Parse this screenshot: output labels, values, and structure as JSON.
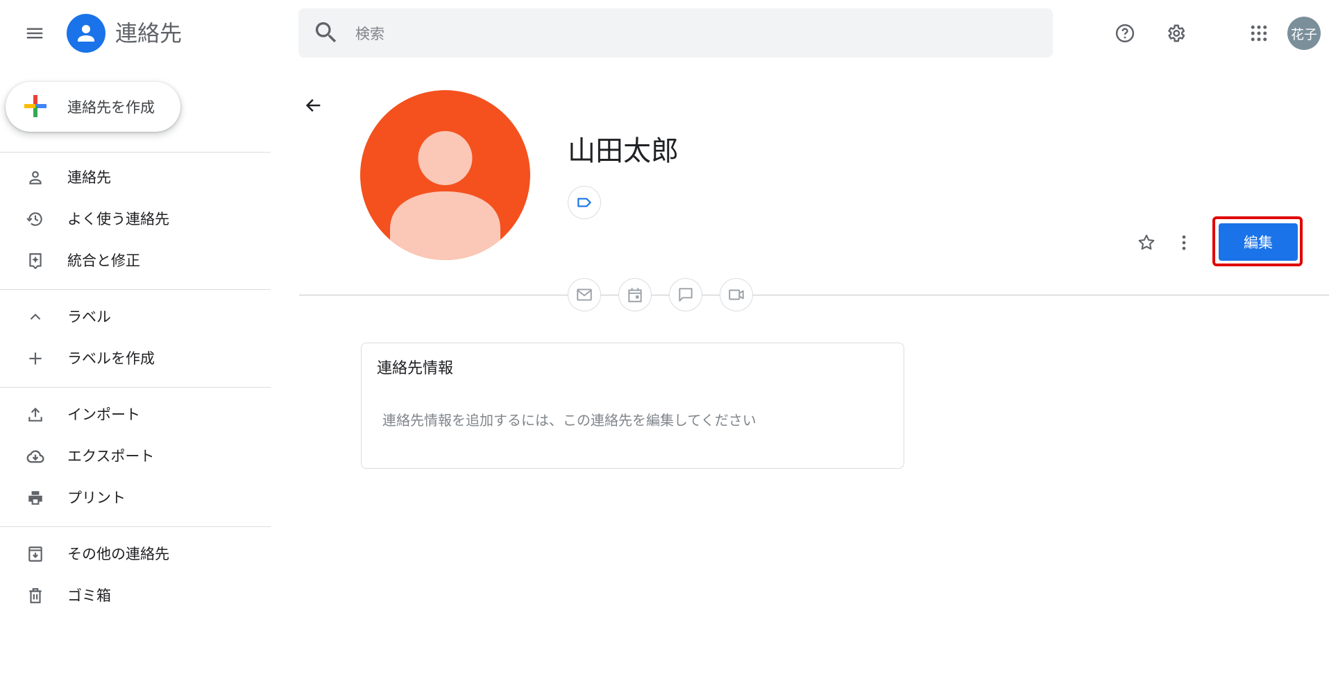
{
  "app": {
    "title": "連絡先",
    "brand_color": "#1a73e8"
  },
  "search": {
    "placeholder": "検索"
  },
  "topbar": {
    "icons": [
      "help-icon",
      "settings-icon",
      "apps-grid-icon"
    ],
    "avatar_text": "花子"
  },
  "sidebar": {
    "create_label": "連絡先を作成",
    "items": [
      {
        "label": "連絡先",
        "icon": "person-icon"
      },
      {
        "label": "よく使う連絡先",
        "icon": "history-icon"
      },
      {
        "label": "統合と修正",
        "icon": "merge-fix-icon"
      },
      {
        "label": "ラベル",
        "icon": "chevron-up-icon"
      },
      {
        "label": "ラベルを作成",
        "icon": "plus-icon"
      },
      {
        "label": "インポート",
        "icon": "upload-icon"
      },
      {
        "label": "エクスポート",
        "icon": "cloud-download-icon"
      },
      {
        "label": "プリント",
        "icon": "print-icon"
      },
      {
        "label": "その他の連絡先",
        "icon": "archive-icon"
      },
      {
        "label": "ゴミ箱",
        "icon": "trash-icon"
      }
    ]
  },
  "contact": {
    "name": "山田太郎",
    "avatar_color": "#f4511e",
    "edit_label": "編集",
    "action_icons": [
      "mail-icon",
      "calendar-icon",
      "chat-icon",
      "video-icon"
    ],
    "info": {
      "title": "連絡先情報",
      "hint": "連絡先情報を追加するには、この連絡先を編集してください"
    }
  }
}
